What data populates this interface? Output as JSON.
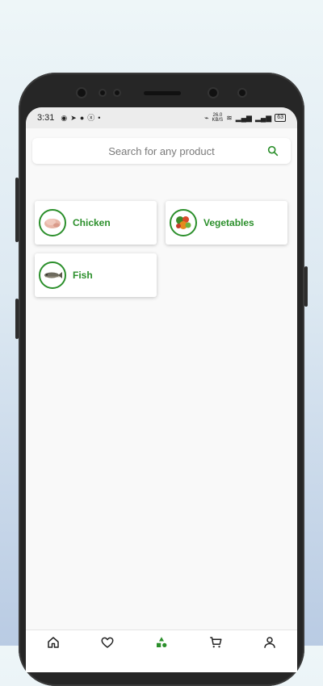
{
  "status_bar": {
    "time": "3:31",
    "network_speed_value": "26.0",
    "network_speed_unit": "KB/S",
    "battery": "63"
  },
  "search": {
    "placeholder": "Search for any product"
  },
  "categories": [
    {
      "label": "Chicken",
      "image": "chicken-image"
    },
    {
      "label": "Vegetables",
      "image": "vegetables-image"
    },
    {
      "label": "Fish",
      "image": "fish-image"
    }
  ],
  "bottom_nav": [
    {
      "icon": "home-icon"
    },
    {
      "icon": "heart-icon"
    },
    {
      "icon": "categories-icon",
      "active": true
    },
    {
      "icon": "cart-icon"
    },
    {
      "icon": "profile-icon"
    }
  ],
  "colors": {
    "accent": "#2b8f2b",
    "background": "#f9f9f9"
  }
}
